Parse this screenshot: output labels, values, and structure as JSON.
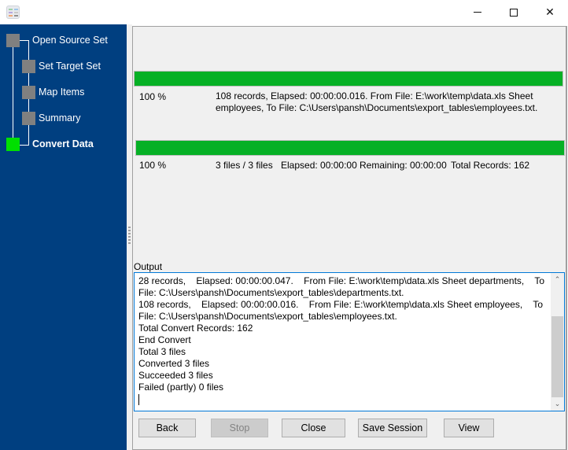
{
  "window": {
    "app_icon": "spreadsheet-convert-icon",
    "controls": {
      "minimize": "—",
      "maximize": "☐",
      "close": "✕"
    }
  },
  "wizard": {
    "steps": [
      {
        "label": "Open Source Set",
        "status": "done"
      },
      {
        "label": "Set Target Set",
        "status": "done"
      },
      {
        "label": "Map Items",
        "status": "done"
      },
      {
        "label": "Summary",
        "status": "done"
      },
      {
        "label": "Convert Data",
        "status": "active"
      }
    ]
  },
  "colors": {
    "sidebar": "#003f80",
    "progress_fill": "#06b025",
    "active_step": "#00e000",
    "inactive_step": "#808080"
  },
  "file_progress": {
    "percent_value": 100,
    "percent": "100 %",
    "detail": "108 records,    Elapsed: 00:00:00.016.    From File: E:\\work\\temp\\data.xls Sheet employees,    To File: C:\\Users\\pansh\\Documents\\export_tables\\employees.txt."
  },
  "total_progress": {
    "percent_value": 100,
    "percent": "100 %",
    "files": "3 files / 3 files",
    "elapsed": "Elapsed: 00:00:00",
    "remaining": "Remaining: 00:00:00",
    "total_records": "Total Records: 162"
  },
  "output": {
    "label": "Output",
    "lines": [
      "28 records,    Elapsed: 00:00:00.047.    From File: E:\\work\\temp\\data.xls Sheet departments,    To File: C:\\Users\\pansh\\Documents\\export_tables\\departments.txt.",
      "108 records,    Elapsed: 00:00:00.016.    From File: E:\\work\\temp\\data.xls Sheet employees,    To File: C:\\Users\\pansh\\Documents\\export_tables\\employees.txt.",
      "Total Convert Records: 162",
      "End Convert",
      "Total 3 files",
      "Converted 3 files",
      "Succeeded 3 files",
      "Failed (partly) 0 files"
    ]
  },
  "buttons": {
    "back": "Back",
    "stop": "Stop",
    "close": "Close",
    "save_session": "Save Session",
    "view": "View"
  }
}
